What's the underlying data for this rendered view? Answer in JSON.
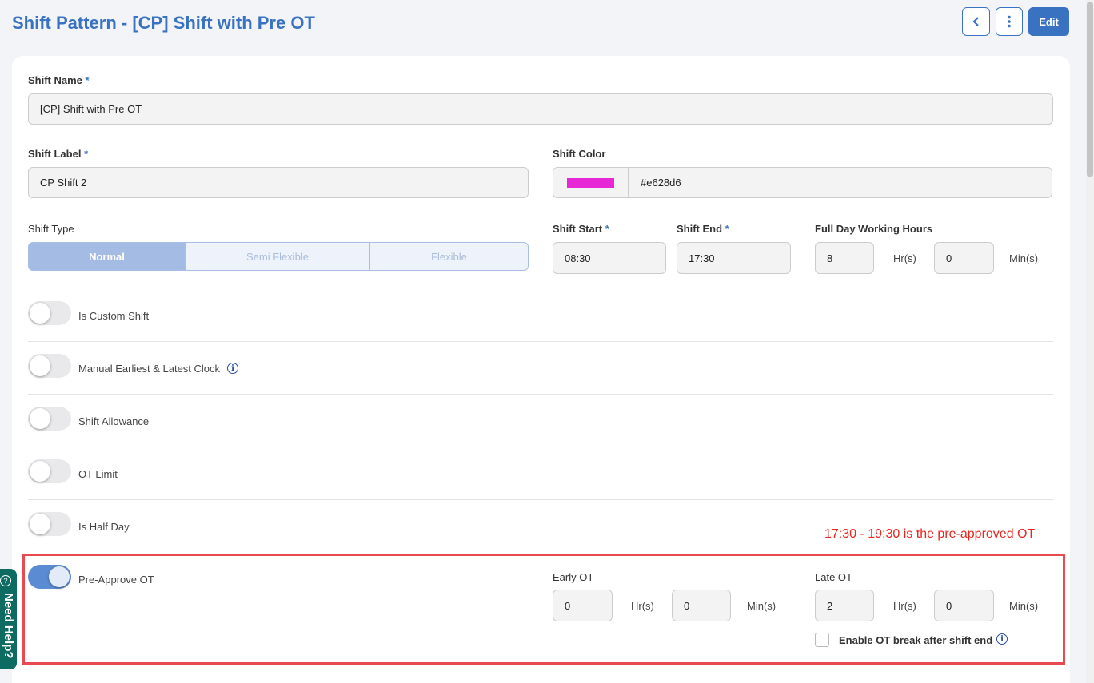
{
  "header": {
    "title": "Shift Pattern - [CP] Shift with Pre OT",
    "edit_label": "Edit",
    "back_icon": "chevron-left-icon",
    "more_icon": "vertical-dots-icon"
  },
  "form": {
    "shift_name": {
      "label": "Shift Name",
      "required": "*",
      "value": "[CP] Shift with Pre OT"
    },
    "shift_label": {
      "label": "Shift Label",
      "required": "*",
      "value": "CP Shift 2"
    },
    "shift_color": {
      "label": "Shift Color",
      "value": "#e628d6",
      "swatch": "#e628d6"
    },
    "shift_type": {
      "label": "Shift Type",
      "options": [
        "Normal",
        "Semi Flexible",
        "Flexible"
      ],
      "selected": "Normal"
    },
    "shift_start": {
      "label": "Shift Start",
      "required": "*",
      "value": "08:30"
    },
    "shift_end": {
      "label": "Shift End",
      "required": "*",
      "value": "17:30"
    },
    "full_day": {
      "label": "Full Day Working Hours",
      "hours": "8",
      "minutes": "0",
      "hr_unit": "Hr(s)",
      "min_unit": "Min(s)"
    }
  },
  "toggles": [
    {
      "label": "Is Custom Shift",
      "on": false
    },
    {
      "label": "Manual Earliest & Latest Clock",
      "on": false
    },
    {
      "label": "Shift Allowance",
      "on": false
    },
    {
      "label": "OT Limit",
      "on": false
    },
    {
      "label": "Is Half Day",
      "on": false
    },
    {
      "label": "Pre-Approve OT",
      "on": true
    }
  ],
  "pre_ot": {
    "note": "17:30 - 19:30  is the pre-approved OT",
    "early_label": "Early OT",
    "early_hours": "0",
    "early_minutes": "0",
    "late_label": "Late OT",
    "late_hours": "2",
    "late_minutes": "0",
    "hr_unit": "Hr(s)",
    "min_unit": "Min(s)",
    "break_label": "Enable OT break after shift end"
  },
  "help": {
    "label": "Need Help?"
  },
  "colors": {
    "accent": "#3a72c2",
    "annotation": "#e84a4f"
  }
}
